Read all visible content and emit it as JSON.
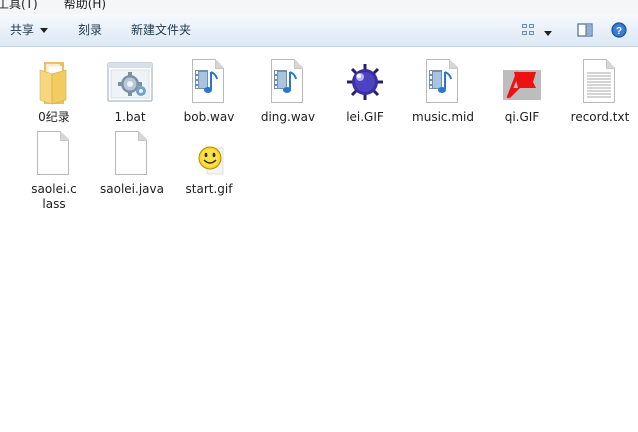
{
  "menu": {
    "items": [
      "工具(T)",
      "帮助(H)"
    ]
  },
  "toolbar": {
    "share_label": "共享",
    "burn_label": "刻录",
    "new_folder_label": "新建文件夹"
  },
  "files": [
    {
      "name": "0纪录",
      "icon": "folder-icon"
    },
    {
      "name": "1.bat",
      "icon": "batch-file-icon"
    },
    {
      "name": "bob.wav",
      "icon": "audio-file-icon"
    },
    {
      "name": "ding.wav",
      "icon": "audio-file-icon"
    },
    {
      "name": "lei.GIF",
      "icon": "mine-image-icon"
    },
    {
      "name": "music.mid",
      "icon": "audio-file-icon"
    },
    {
      "name": "qi.GIF",
      "icon": "flag-image-icon"
    },
    {
      "name": "record.txt",
      "icon": "text-file-icon"
    },
    {
      "name": "saolei.class",
      "icon": "blank-file-icon"
    },
    {
      "name": "saolei.java",
      "icon": "blank-file-icon"
    },
    {
      "name": "start.gif",
      "icon": "smiley-image-icon"
    }
  ],
  "colors": {
    "toolbar_bg": "#e3ecf7",
    "folder": "#f5d67a",
    "window_bg": "#ffffff"
  }
}
